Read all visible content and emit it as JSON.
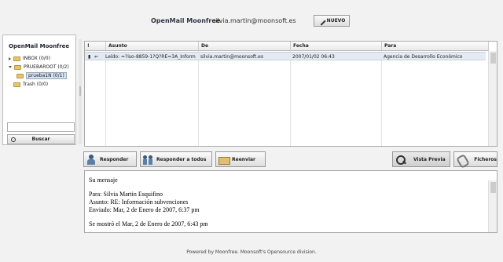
{
  "header": {
    "app_name": "OpenMail Moonfree",
    "user_email": "silvia.martin@moonsoft.es",
    "new_button_label": "NUEVO"
  },
  "sidebar": {
    "title": "OpenMail Moonfree",
    "folders": [
      {
        "label": "INBOX (0/0)",
        "level": 0,
        "expander": "collapsed"
      },
      {
        "label": "PRUEBAROOT (0/2)",
        "level": 0,
        "expander": "expanded"
      },
      {
        "label": "prueba1N (0/1)",
        "level": 1,
        "expander": "none",
        "selected": true
      },
      {
        "label": "Trash (0/0)",
        "level": 0,
        "expander": "none"
      }
    ],
    "search_value": "",
    "search_button_label": "Buscar"
  },
  "message_list": {
    "columns": [
      "!",
      "Asunto",
      "De",
      "Fecha",
      "Para"
    ],
    "rows": [
      {
        "subject": "Leído: =?iso-8859-1?Q?RE=3A_Inform",
        "from": "silvia.martin@moonsoft.es",
        "date": "2007/01/02 06:43",
        "to": "Agencia de Desarrollo Económico"
      }
    ]
  },
  "toolbar": {
    "reply_label": "Responder",
    "reply_all_label": "Responder a todos",
    "forward_label": "Reenviar",
    "preview_label": "Vista Previa",
    "files_label": "Ficheros"
  },
  "preview": {
    "lines": [
      "Su mensaje",
      "",
      "Para: Silvia Martin Esquifino",
      "Asunto: RE: Información subvenciones",
      "Enviado: Mar, 2 de Enero de 2007, 6:37 pm",
      "",
      "Se mostró el Mar, 2 de Enero de 2007, 6:43 pm"
    ]
  },
  "footer": {
    "text": "Powered by Moonfree. Moonsoft's Opensource division."
  }
}
